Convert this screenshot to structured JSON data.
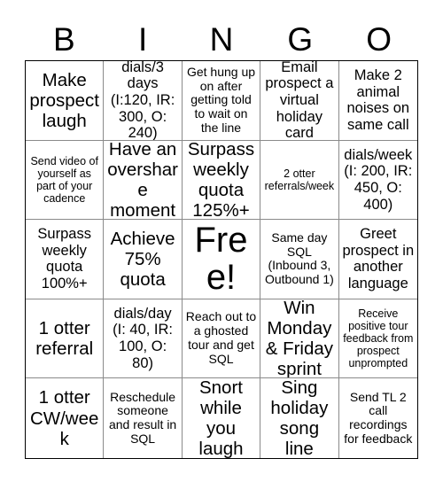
{
  "header": {
    "letters": [
      "B",
      "I",
      "N",
      "G",
      "O"
    ]
  },
  "grid": {
    "rows": 5,
    "columns": 5,
    "cells": [
      {
        "text": "Make prospect laugh",
        "size": "lg"
      },
      {
        "text": "dials/3 days (I:120, IR: 300, O: 240)",
        "size": "md"
      },
      {
        "text": "Get hung up on after getting told to wait on the line",
        "size": "sm"
      },
      {
        "text": "Email prospect a virtual holiday card",
        "size": "md"
      },
      {
        "text": "Make 2 animal noises on same call",
        "size": "md"
      },
      {
        "text": "Send video of yourself as part of your cadence",
        "size": "xs"
      },
      {
        "text": "Have an overshare moment",
        "size": "lg"
      },
      {
        "text": "Surpass weekly quota 125%+",
        "size": "lg"
      },
      {
        "text": "2 otter referrals/week",
        "size": "xs"
      },
      {
        "text": "dials/week (I: 200, IR: 450, O: 400)",
        "size": "md"
      },
      {
        "text": "Surpass weekly quota 100%+",
        "size": "md"
      },
      {
        "text": "Achieve 75% quota",
        "size": "lg"
      },
      {
        "text": "Free!",
        "size": "xl"
      },
      {
        "text": "Same day SQL (Inbound 3, Outbound 1)",
        "size": "sm"
      },
      {
        "text": "Greet prospect in another language",
        "size": "md"
      },
      {
        "text": "1 otter referral",
        "size": "lg"
      },
      {
        "text": "dials/day (I: 40, IR: 100, O: 80)",
        "size": "md"
      },
      {
        "text": "Reach out to a ghosted tour and get SQL",
        "size": "sm"
      },
      {
        "text": "Win Monday & Friday sprint",
        "size": "lg"
      },
      {
        "text": "Receive positive tour feedback from prospect unprompted",
        "size": "xs"
      },
      {
        "text": "1 otter CW/week",
        "size": "lg"
      },
      {
        "text": "Reschedule someone and result in SQL",
        "size": "sm"
      },
      {
        "text": "Snort while you laugh",
        "size": "lg"
      },
      {
        "text": "Sing holiday song line",
        "size": "lg"
      },
      {
        "text": "Send TL 2 call recordings for feedback",
        "size": "sm"
      }
    ]
  },
  "colors": {
    "background": "#ffffff",
    "text": "#000000",
    "outer_border": "#000000",
    "inner_border": "#8a8a8a"
  }
}
